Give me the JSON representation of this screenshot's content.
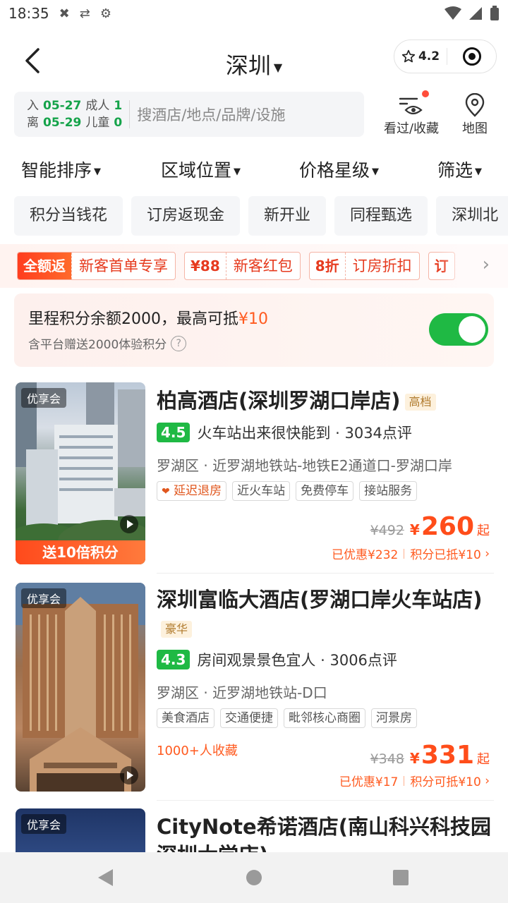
{
  "status_bar": {
    "time": "18:35"
  },
  "header": {
    "city": "深圳",
    "capsule_rating": "4.2"
  },
  "search": {
    "checkin_label": "入",
    "checkin_date": "05-27",
    "checkout_label": "离",
    "checkout_date": "05-29",
    "adults_label": "成人",
    "adults": "1",
    "children_label": "儿童",
    "children": "0",
    "placeholder": "搜酒店/地点/品牌/设施",
    "history_label": "看过/收藏",
    "map_label": "地图"
  },
  "sort": [
    "智能排序",
    "区域位置",
    "价格星级",
    "筛选"
  ],
  "tags": [
    "积分当钱花",
    "订房返现金",
    "新开业",
    "同程甄选",
    "深圳北"
  ],
  "promos": [
    {
      "left": "全额返",
      "right": "新客首单专享",
      "solid": true
    },
    {
      "left": "¥88",
      "right": "新客红包",
      "solid": false
    },
    {
      "left": "8折",
      "right": "订房折扣",
      "solid": false
    },
    {
      "left": "订",
      "right": "",
      "solid": false
    }
  ],
  "points": {
    "text_main": "里程积分余额2000，最高可抵",
    "text_amount": "¥10",
    "text_sub": "含平台赠送2000体验积分",
    "toggle_on": true
  },
  "hotels": [
    {
      "badge": "优享会",
      "ribbon": "送10倍积分",
      "name": "柏高酒店(深圳罗湖口岸店)",
      "grade": "高档",
      "score": "4.5",
      "highlight": "火车站出来很快能到",
      "reviews": "· 3034点评",
      "location": "罗湖区 · 近罗湖地铁站-地铁E2通道口-罗湖口岸",
      "features": [
        "延迟退房",
        "近火车站",
        "免费停车",
        "接站服务"
      ],
      "collect": "",
      "orig_price": "¥492",
      "currency": "¥",
      "price": "260",
      "qi": "起",
      "saved": "已优惠¥232",
      "points_used": "积分已抵¥10"
    },
    {
      "badge": "优享会",
      "ribbon": "",
      "name": "深圳富临大酒店(罗湖口岸火车站店)",
      "grade": "豪华",
      "score": "4.3",
      "highlight": "房间观景景色宜人",
      "reviews": "· 3006点评",
      "location": "罗湖区 · 近罗湖地铁站-D口",
      "features": [
        "美食酒店",
        "交通便捷",
        "毗邻核心商圈",
        "河景房"
      ],
      "collect": "1000+人收藏",
      "orig_price": "¥348",
      "currency": "¥",
      "price": "331",
      "qi": "起",
      "saved": "已优惠¥17",
      "points_used": "积分可抵¥10"
    },
    {
      "badge": "优享会",
      "name": "CityNote希诺酒店(南山科兴科技园深圳大学店)"
    }
  ]
}
